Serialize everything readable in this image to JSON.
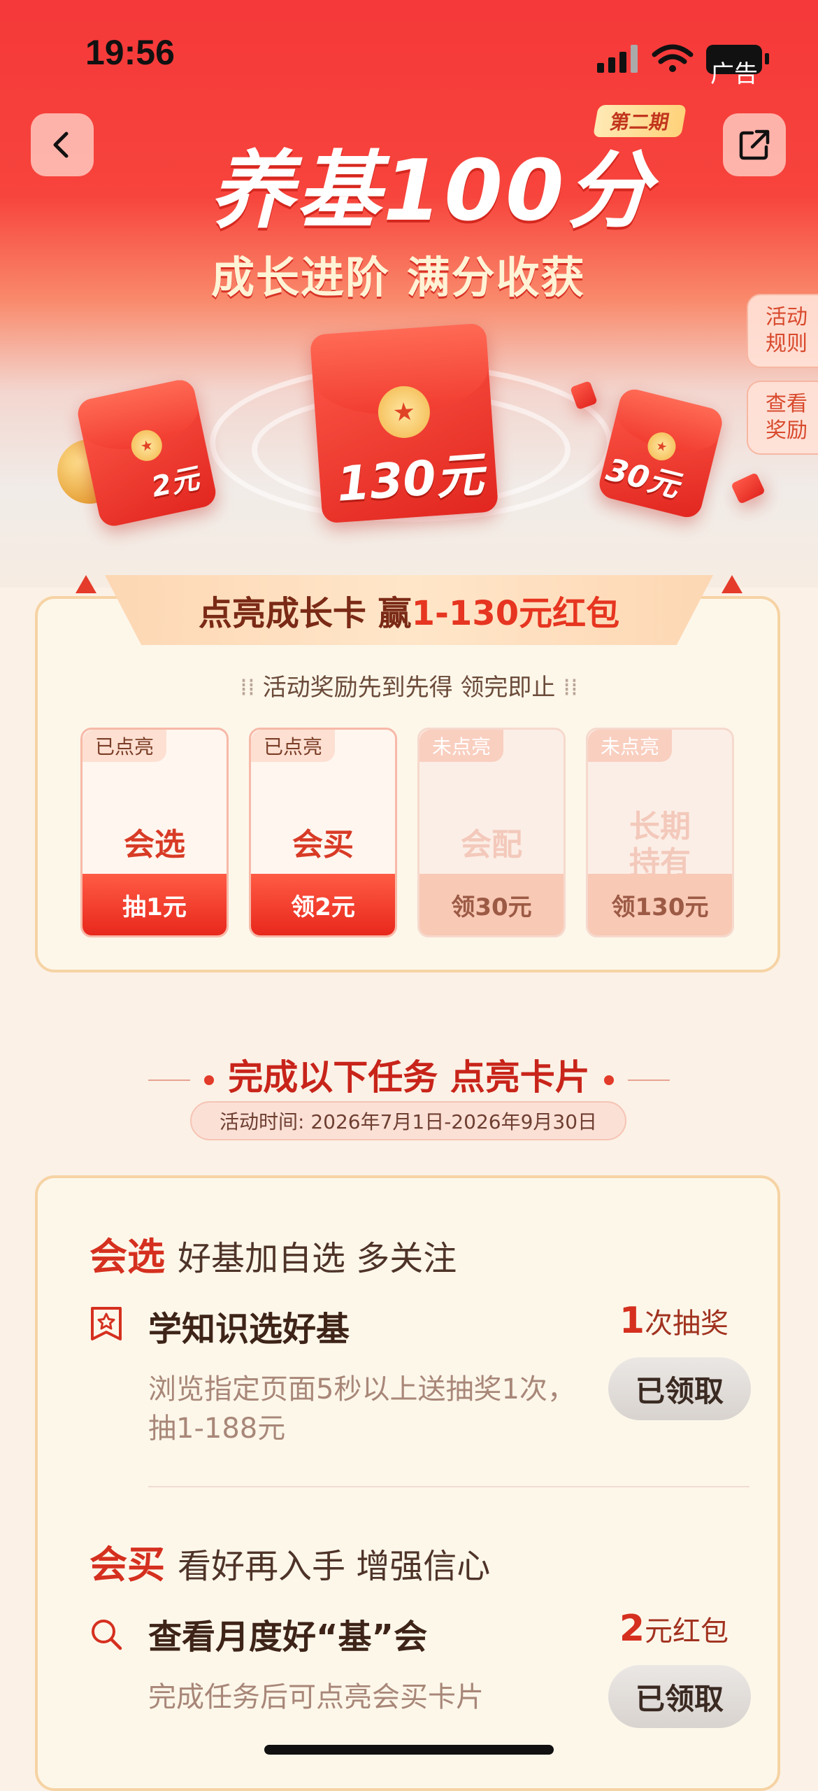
{
  "status_bar": {
    "time": "19:56",
    "ad_label": "广告"
  },
  "hero": {
    "issue_tag": "第二期",
    "title": "养基100分",
    "subtitle": "成长进阶 满分收获",
    "side_buttons": [
      "活动\n规则",
      "查看\n奖励"
    ],
    "envelopes": {
      "left": "2元",
      "center": "130元",
      "right": "30元"
    }
  },
  "growth": {
    "banner_prefix": "点亮成长卡 赢",
    "banner_highlight": "1-130元红包",
    "notice": "活动奖励先到先得 领完即止",
    "cards": [
      {
        "state": "已点亮",
        "name": "会选",
        "reward": "抽1元",
        "lit": true
      },
      {
        "state": "已点亮",
        "name": "会买",
        "reward": "领2元",
        "lit": true
      },
      {
        "state": "未点亮",
        "name": "会配",
        "reward": "领30元",
        "lit": false
      },
      {
        "state": "未点亮",
        "name": "长期\n持有",
        "reward": "领130元",
        "lit": false
      }
    ]
  },
  "tasks": {
    "title": "完成以下任务 点亮卡片",
    "period": "活动时间: 2026年7月1日-2026年9月30日",
    "sections": [
      {
        "head": "会选",
        "head_desc": "好基加自选 多关注",
        "task_name": "学知识选好基",
        "reward_num": "1",
        "reward_unit": "次抽奖",
        "desc": "浏览指定页面5秒以上送抽奖1次，抽1-188元",
        "button": "已领取",
        "icon": "star-bookmark-icon"
      },
      {
        "head": "会买",
        "head_desc": "看好再入手 增强信心",
        "task_name": "查看月度好“基”会",
        "reward_num": "2",
        "reward_unit": "元红包",
        "desc": "完成任务后可点亮会买卡片",
        "button": "已领取",
        "icon": "search-icon"
      }
    ]
  },
  "colors": {
    "brand_red": "#f5383a",
    "accent": "#d5301f",
    "panel_bg": "#fdf7ea"
  }
}
